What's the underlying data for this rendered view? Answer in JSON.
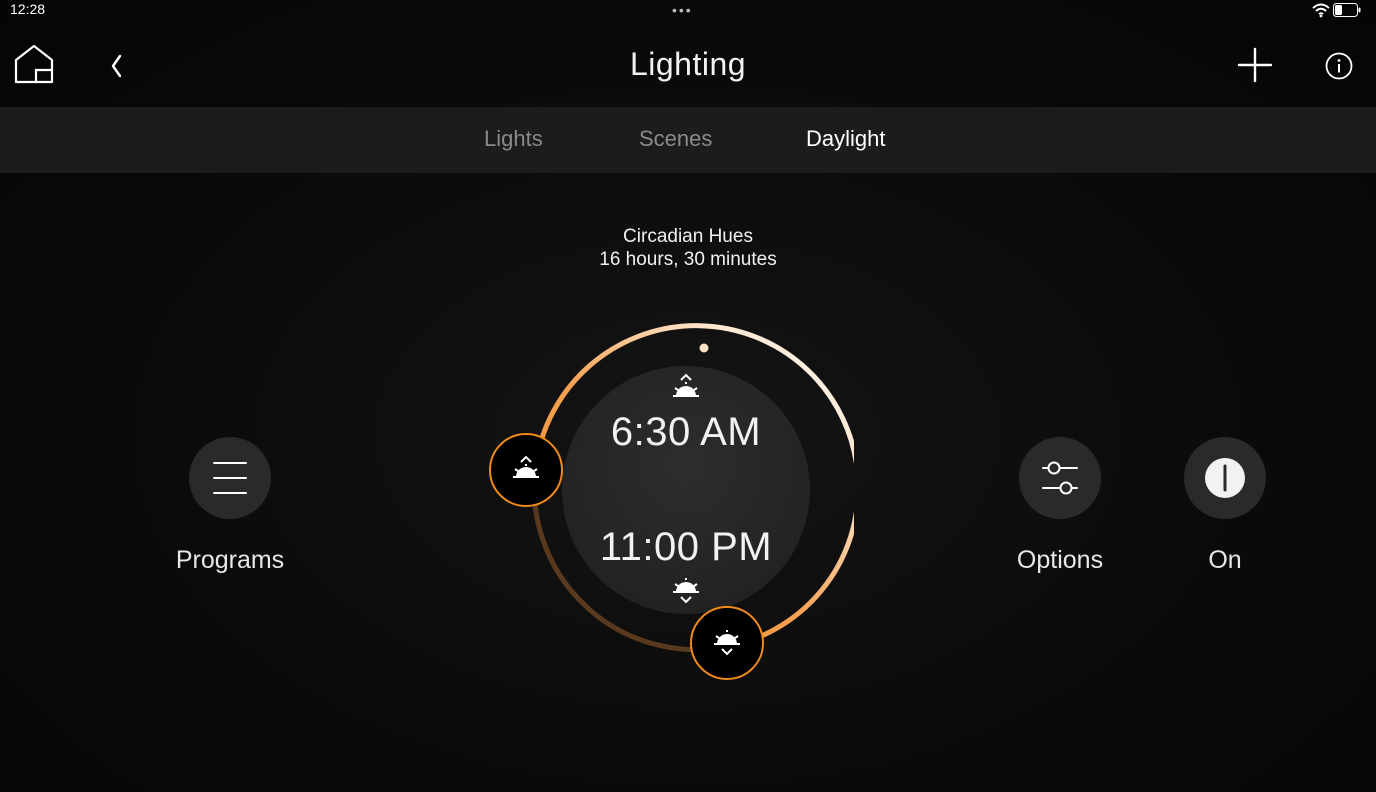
{
  "status_bar": {
    "time": "12:28",
    "dots": "•••"
  },
  "header": {
    "title": "Lighting"
  },
  "tabs": [
    {
      "label": "Lights",
      "active": false
    },
    {
      "label": "Scenes",
      "active": false
    },
    {
      "label": "Daylight",
      "active": true
    }
  ],
  "program": {
    "name": "Circadian Hues",
    "duration": "16 hours, 30 minutes"
  },
  "dial": {
    "start_time": "6:30 AM",
    "end_time": "11:00 PM"
  },
  "controls": {
    "programs_label": "Programs",
    "options_label": "Options",
    "power_label": "On"
  },
  "colors": {
    "accent": "#f08a1c",
    "tab_bar": "#1c1c1c",
    "button_bg": "#2a2a2a"
  }
}
